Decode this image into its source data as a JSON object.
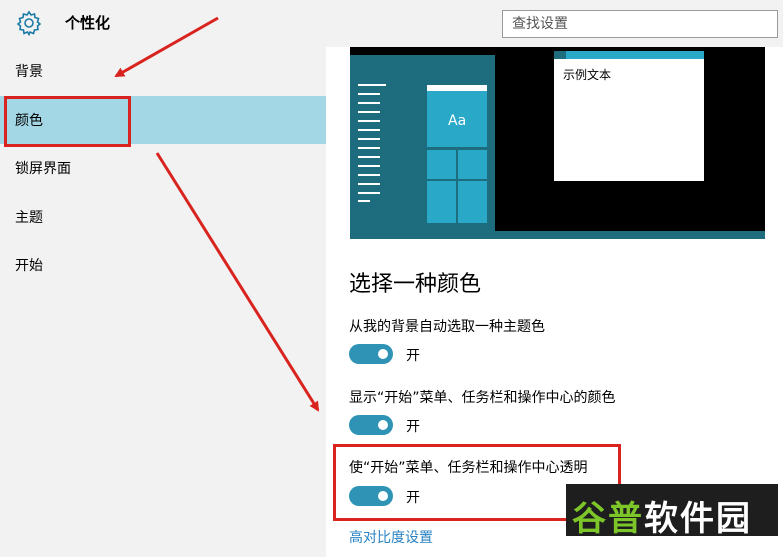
{
  "header": {
    "title": "个性化",
    "icon": "gear-icon"
  },
  "search": {
    "placeholder": "查找设置"
  },
  "sidebar": {
    "items": [
      {
        "label": "背景"
      },
      {
        "label": "颜色",
        "selected": true
      },
      {
        "label": "锁屏界面"
      },
      {
        "label": "主题"
      },
      {
        "label": "开始"
      }
    ]
  },
  "preview": {
    "sample_text": "示例文本",
    "tile_text": "Aa"
  },
  "main": {
    "section_title": "选择一种颜色",
    "settings": [
      {
        "label": "从我的背景自动选取一种主题色",
        "state": "开",
        "on": true
      },
      {
        "label": "显示“开始”菜单、任务栏和操作中心的颜色",
        "state": "开",
        "on": true
      },
      {
        "label": "使“开始”菜单、任务栏和操作中心透明",
        "state": "开",
        "on": true
      }
    ],
    "link": "高对比度设置"
  },
  "watermark": {
    "text_green": "谷普",
    "text_white": "软件园"
  },
  "colors": {
    "accent": "#2e93b5",
    "selected": "#a3d7e5",
    "annotation": "#d9231f",
    "link": "#2a82c2"
  }
}
